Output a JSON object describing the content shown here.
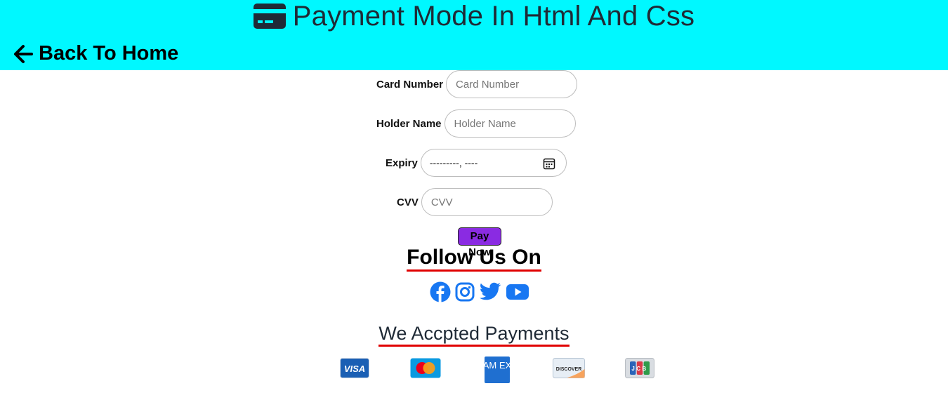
{
  "header": {
    "title": "Payment Mode In Html And Css",
    "title_icon": "credit-card-icon",
    "back_link": "Back To Home",
    "back_icon": "arrow-left-icon",
    "background": "#00f8ff"
  },
  "form": {
    "card_number": {
      "label": "Card Number",
      "placeholder": "Card Number"
    },
    "holder_name": {
      "label": "Holder Name",
      "placeholder": "Holder Name"
    },
    "expiry": {
      "label": "Expiry",
      "value": "---------, ----",
      "icon": "calendar-icon"
    },
    "cvv": {
      "label": "CVV",
      "placeholder": "CVV"
    },
    "pay_button": "Pay Now",
    "pay_button_color": "#8a2be2"
  },
  "follow": {
    "title": "Follow Us On",
    "underline_color": "#e00000",
    "icons": [
      "facebook-icon",
      "instagram-icon",
      "twitter-icon",
      "youtube-icon"
    ],
    "icon_color": "#1877f2"
  },
  "payments": {
    "title": "We Accpted Payments",
    "cards": [
      {
        "name": "visa-icon",
        "text": "VISA"
      },
      {
        "name": "mastercard-icon"
      },
      {
        "name": "amex-icon",
        "text": "AM EX"
      },
      {
        "name": "discover-icon",
        "text": "DISCOVER"
      },
      {
        "name": "jcb-icon",
        "text": "JCB"
      }
    ]
  }
}
